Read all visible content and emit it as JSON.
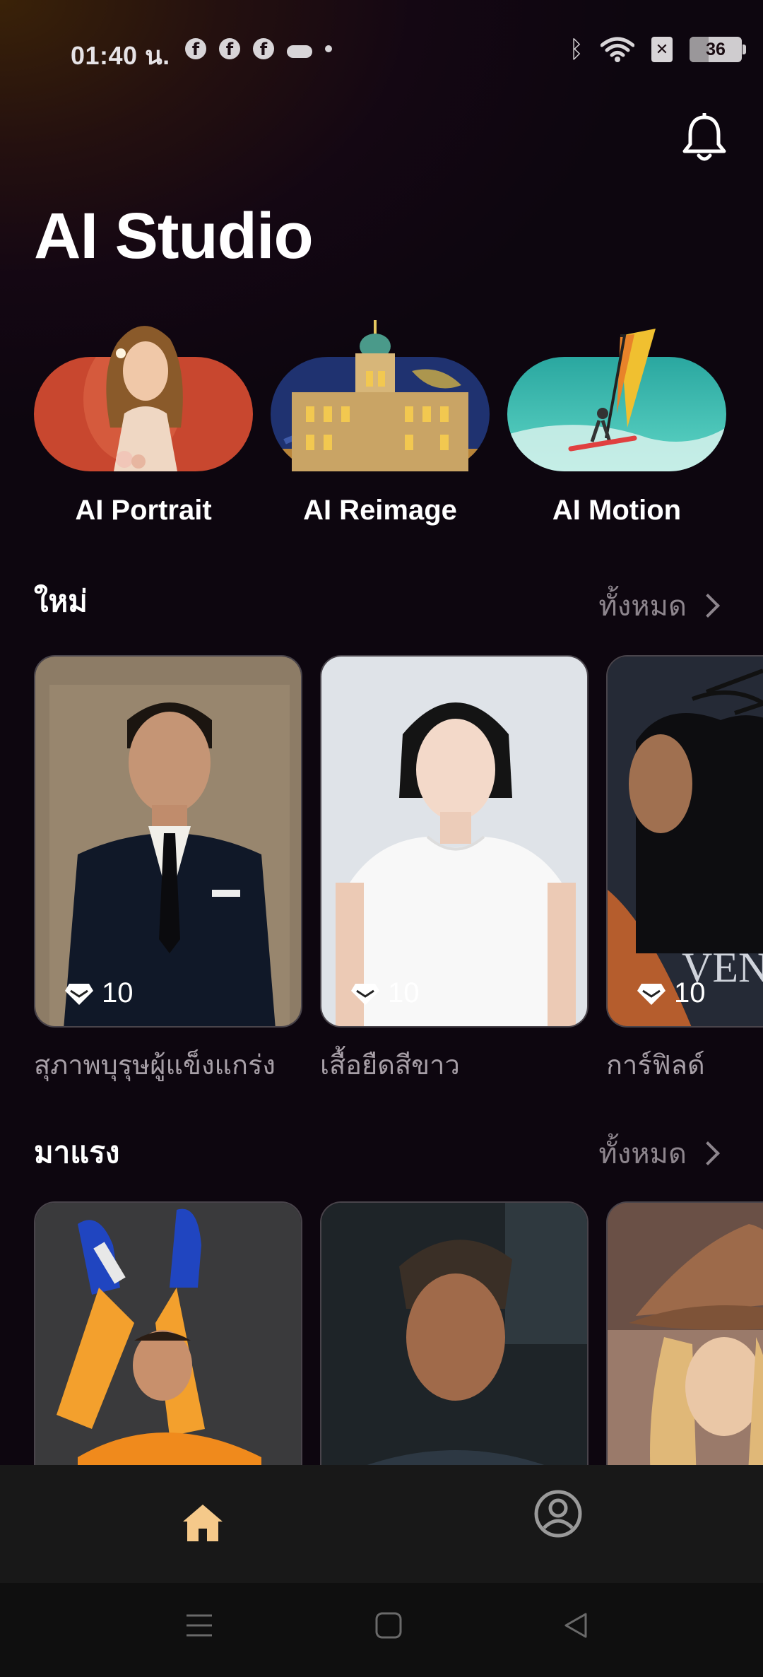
{
  "status_bar": {
    "time": "01:40 น.",
    "notif_icons": [
      "facebook-icon",
      "facebook-icon",
      "facebook-icon",
      "cloud-icon",
      "dot-icon"
    ],
    "sim_label": "✕",
    "battery_level": "36"
  },
  "header": {
    "title": "AI Studio",
    "bell_icon": "bell-icon"
  },
  "features": [
    {
      "label": "AI Portrait",
      "color": "#c8472f"
    },
    {
      "label": "AI Reimage",
      "color": "#2a3e7a"
    },
    {
      "label": "AI Motion",
      "color": "#3fc7b0"
    }
  ],
  "sections": {
    "new": {
      "title": "ใหม่",
      "see_all": "ทั้งหมด",
      "items": [
        {
          "label": "สุภาพบุรุษผู้แข็งแกร่ง",
          "cost": "10"
        },
        {
          "label": "เสื้อยืดสีขาว",
          "cost": "10"
        },
        {
          "label": "การ์ฟิลด์",
          "cost": "10"
        }
      ]
    },
    "trending": {
      "title": "มาแรง",
      "see_all": "ทั้งหมด"
    }
  },
  "poster_text": {
    "title": "VENO"
  },
  "bottom_nav": {
    "home_icon": "home-icon",
    "profile_icon": "profile-icon",
    "accent": "#f5c98a"
  },
  "system_nav": [
    "menu-icon",
    "square-icon",
    "back-icon"
  ]
}
